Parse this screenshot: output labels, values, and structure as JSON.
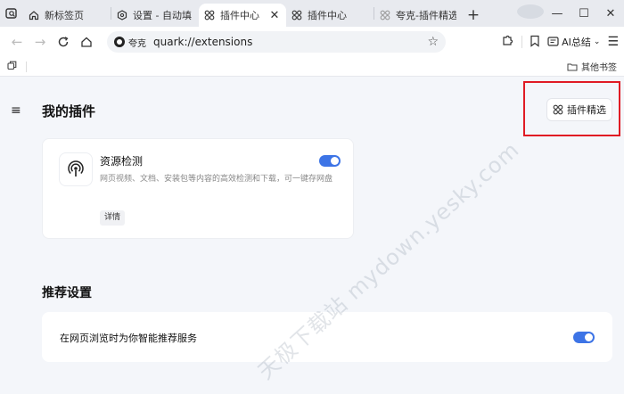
{
  "tabs": [
    {
      "title": "新标签页",
      "icon": "home-icon",
      "active": false
    },
    {
      "title": "设置 - 自动填",
      "icon": "settings-hex-icon",
      "active": false
    },
    {
      "title": "插件中心",
      "icon": "extensions-icon",
      "active": true
    },
    {
      "title": "插件中心",
      "icon": "extensions-icon",
      "active": false
    },
    {
      "title": "夸克-插件精选",
      "icon": "extensions-icon",
      "active": false
    }
  ],
  "toolbar": {
    "site_chip": "夸克",
    "url": "quark://extensions",
    "ai_label": "AI总结"
  },
  "bookmarks": {
    "other_label": "其他书签"
  },
  "page": {
    "title": "我的插件",
    "featured_button": "插件精选"
  },
  "extension": {
    "name": "资源检测",
    "description": "网页视频、文档、安装包等内容的高效检测和下载，可一键存网盘",
    "details_button": "详情",
    "enabled": true
  },
  "recommend": {
    "section_title": "推荐设置",
    "setting_label": "在网页浏览时为你智能推荐服务",
    "enabled": true
  },
  "watermark": "天极下载站 mydown.yesky.com",
  "colors": {
    "accent": "#3d74e6",
    "highlight": "#e01b24"
  }
}
